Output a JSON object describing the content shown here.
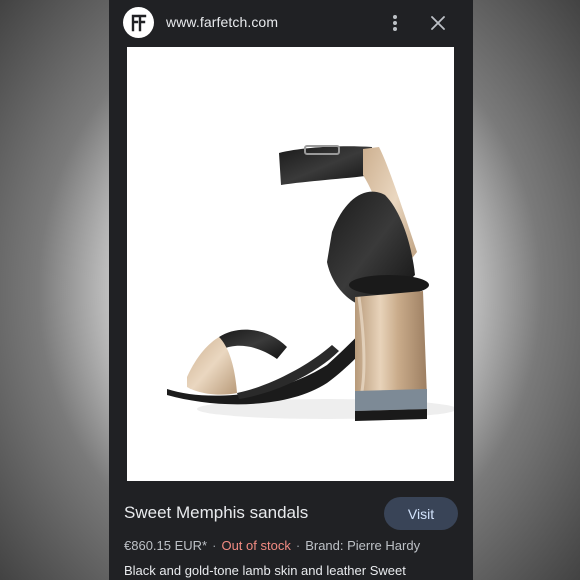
{
  "header": {
    "site_logo_text": "FF",
    "url": "www.farfetch.com",
    "more_icon": "more-vert-icon",
    "close_icon": "close-icon"
  },
  "product": {
    "image_alt": "sandal-product-image",
    "title": "Sweet Memphis sandals",
    "visit_label": "Visit",
    "price": "€860.15 EUR*",
    "separator": "·",
    "stock_status": "Out of stock",
    "brand": "Brand: Pierre Hardy",
    "description": "Black and gold-tone lamb skin and leather Sweet"
  },
  "colors": {
    "panel_bg": "#202124",
    "visit_bg": "#394457",
    "visit_text": "#d2e3fc",
    "out_of_stock": "#f28b82"
  }
}
